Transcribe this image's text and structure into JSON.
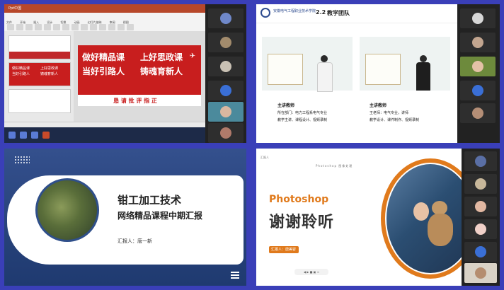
{
  "q1": {
    "window_title": "Ppt中国",
    "ribbon_tabs": [
      "文件",
      "开始",
      "插入",
      "设计",
      "切换",
      "动画",
      "幻灯片放映",
      "审阅",
      "视图"
    ],
    "slide_line1_left": "做好精品课",
    "slide_line1_right": "上好思政课",
    "slide_line2_left": "当好引路人",
    "slide_line2_right": "铸魂育新人",
    "slide_band": "恳 请 批 评 指 正",
    "thumb_lines": [
      "做好精品课",
      "上好思政课",
      "当好引路人",
      "铸魂育新人"
    ]
  },
  "q2": {
    "school": "安徽电气工程职业技术学院",
    "section_num": "2.2",
    "section_title": "教学团队",
    "left": {
      "badge": "主讲教师",
      "line1": "所在部门：电力工程系电气专业",
      "line2": "教学主讲、课程设计、视频录制"
    },
    "right": {
      "badge": "主讲教师",
      "line1": "王老师：电气专业，讲师",
      "line2": "教学设计、课件制作、视频录制"
    }
  },
  "q3": {
    "title1": "钳工加工技术",
    "title2": "网络精品课程中期汇报",
    "reporter": "汇报人：唐一新"
  },
  "q4": {
    "top_label": "汇报人",
    "mid_label": "Photoshop 图像处理",
    "ps": "Photoshop",
    "thanks": "谢谢聆听",
    "badge": "汇报人：唐美容",
    "ctrl": "◀ ▶ ■ ▣ ≡"
  },
  "colors": {
    "frame": "#3a3fb8",
    "ppt_red": "#c81e1e",
    "navy": "#2d4b8f",
    "orange": "#e07a1c"
  },
  "icons": [
    "powerpoint-icon",
    "school-logo-icon",
    "hamburger-menu-icon",
    "user-avatar-icon"
  ]
}
